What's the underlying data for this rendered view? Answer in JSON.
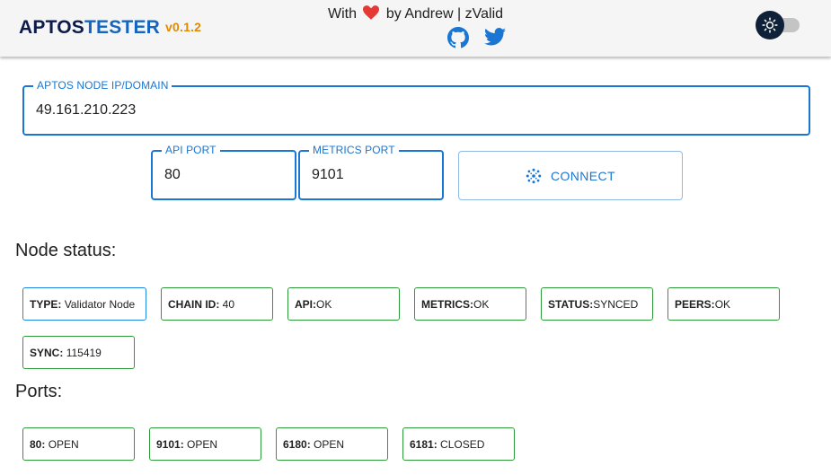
{
  "header": {
    "brand_part1": "APTOS",
    "brand_part2": "TESTER",
    "version": "v0.1.2",
    "tagline_before": "With",
    "tagline_after": "by Andrew | zValid",
    "heart_icon": "heart-icon",
    "links": [
      {
        "name": "github-icon"
      },
      {
        "name": "twitter-icon"
      }
    ],
    "theme_toggle_icon": "sun-icon"
  },
  "form": {
    "node_label": "APTOS NODE IP/DOMAIN",
    "node_value": "49.161.210.223",
    "api_port_label": "API PORT",
    "api_port_value": "80",
    "metrics_port_label": "METRICS PORT",
    "metrics_port_value": "9101",
    "connect_label": "CONNECT"
  },
  "node_status": {
    "title": "Node status:",
    "items": [
      {
        "key": "TYPE:",
        "value": "Validator Node"
      },
      {
        "key": "CHAIN ID:",
        "value": "40"
      },
      {
        "key": "API:",
        "value": "OK"
      },
      {
        "key": "METRICS:",
        "value": "OK"
      },
      {
        "key": "STATUS:",
        "value": "SYNCED"
      },
      {
        "key": "PEERS:",
        "value": "OK"
      },
      {
        "key": "SYNC:",
        "value": "115419"
      }
    ]
  },
  "ports": {
    "title": "Ports:",
    "items": [
      {
        "key": "80:",
        "value": "OPEN"
      },
      {
        "key": "9101:",
        "value": "OPEN"
      },
      {
        "key": "6180:",
        "value": "OPEN"
      },
      {
        "key": "6181:",
        "value": "CLOSED"
      }
    ]
  },
  "colors": {
    "accent": "#1976d2",
    "ok_border": "#2e9a3a",
    "brand_dark": "#0d1b4b",
    "version": "#e08a00",
    "heart": "#e53935"
  }
}
